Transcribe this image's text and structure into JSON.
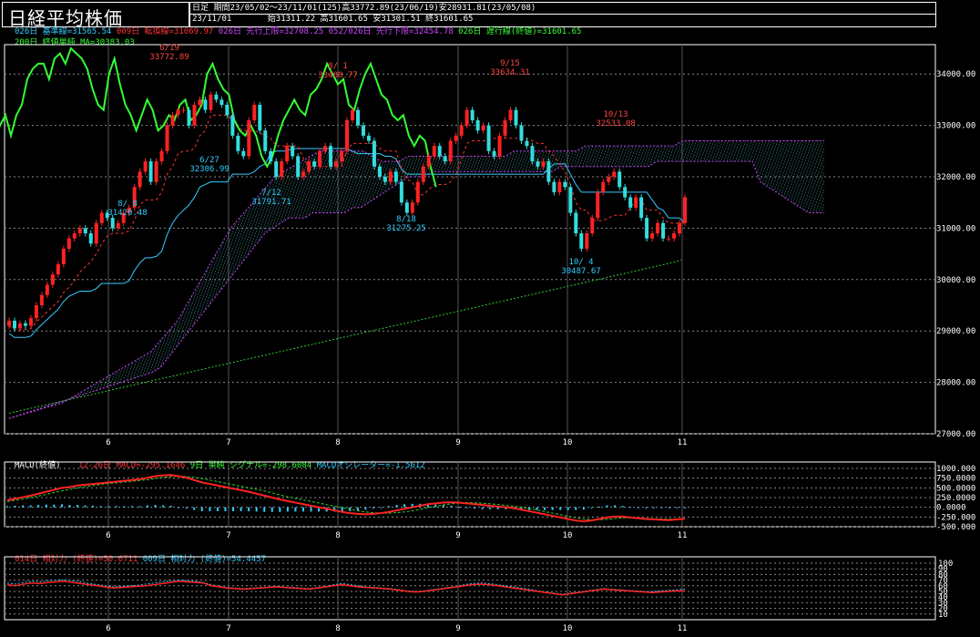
{
  "title": "日経平均株価",
  "header": {
    "period_label": "日足",
    "period_info": "期間23/05/02～23/11/01(125)高33772.89(23/06/19)安28931.81(23/05/08)",
    "date": "23/11/01",
    "ohlc": "始31311.22 高31601.65 安31301.51 終31601.65"
  },
  "main_legend": {
    "kijun": {
      "text": "026日 基準線=31565.54",
      "color": "#33ccff"
    },
    "tenkan": {
      "text": "009日 転換線=31069.97",
      "color": "#ff3333"
    },
    "senkou1": {
      "text": "026日 先行上限=32708.25",
      "color": "#cc44ff"
    },
    "senkou2": {
      "text": "052/026日 先行下限=32454.78",
      "color": "#cc44ff"
    },
    "chikou": {
      "text": "026日 遅行線(終値)=31601.65",
      "color": "#33ff33"
    },
    "ma200": {
      "text": "200日 終値単純 MA=30383.03",
      "color": "#33ff33"
    }
  },
  "macd_legend": {
    "label": {
      "text": "MACD(終値)",
      "color": "#ffffff"
    },
    "macd": {
      "text": "12-26日 MACD=-295.1646",
      "color": "#ff3333"
    },
    "signal": {
      "text": "9日 単純 シグナル=-298.6084",
      "color": "#33ff33"
    },
    "osc": {
      "text": "MACDオシレーター=-1.5612",
      "color": "#33ccff"
    }
  },
  "rsi_legend": {
    "rsi14": {
      "text": "014日 相対力 (終値)=50.6711",
      "color": "#ff3333"
    },
    "rsi9": {
      "text": "009日 相対力 (終値)=54.4457",
      "color": "#33ccff"
    }
  },
  "chart_data": [
    {
      "type": "candlestick",
      "title": "日経平均株価",
      "ylim": [
        27000,
        34500
      ],
      "y_ticks": [
        "34000.00",
        "33000.00",
        "32000.00",
        "31000.00",
        "30000.00",
        "29000.00",
        "28000.00",
        "27000.00"
      ],
      "x_ticks": [
        "6",
        "7",
        "8",
        "9",
        "10",
        "11"
      ],
      "annotations": [
        {
          "label": "6/19",
          "value": "33772.89"
        },
        {
          "label": "8/ 1",
          "value": "33488.77"
        },
        {
          "label": "9/15",
          "value": "33634.31"
        },
        {
          "label": "10/13",
          "value": "32533.08"
        },
        {
          "label": "8/ 8",
          "value": "31420.48"
        },
        {
          "label": "6/27",
          "value": "32306.99"
        },
        {
          "label": "7/12",
          "value": "31791.71"
        },
        {
          "label": "8/18",
          "value": "31275.25"
        },
        {
          "label": "10/ 4",
          "value": "30487.67"
        }
      ],
      "close": [
        29200,
        29050,
        29150,
        29100,
        29250,
        29500,
        29700,
        29900,
        30100,
        30300,
        30600,
        30800,
        30900,
        31000,
        30900,
        30700,
        31100,
        31300,
        31200,
        31000,
        31100,
        31300,
        31400,
        31800,
        32100,
        32300,
        31900,
        32300,
        32500,
        33000,
        33200,
        33300,
        33300,
        33000,
        33400,
        33500,
        33300,
        33600,
        33500,
        33400,
        33200,
        32800,
        32500,
        32400,
        33100,
        33400,
        32900,
        32500,
        32300,
        32000,
        32300,
        32600,
        32400,
        32000,
        32100,
        32300,
        32200,
        32500,
        32600,
        32200,
        32300,
        32500,
        33100,
        33300,
        33000,
        32800,
        32700,
        32200,
        32000,
        31900,
        32100,
        31900,
        31500,
        31300,
        31500,
        31900,
        32200,
        32400,
        32600,
        32400,
        32300,
        32700,
        32800,
        33000,
        33300,
        33100,
        32900,
        33000,
        32500,
        32400,
        32800,
        33100,
        33300,
        33000,
        32700,
        32600,
        32300,
        32200,
        32300,
        31900,
        31700,
        31900,
        31800,
        31300,
        30900,
        30600,
        30900,
        31200,
        31700,
        31900,
        32000,
        32100,
        31800,
        31600,
        31400,
        31600,
        31200,
        30800,
        30900,
        31100,
        30800,
        30800,
        30900,
        31100,
        31602
      ],
      "ma200": [
        27400,
        27430,
        27460,
        27490,
        27520,
        27550,
        27580,
        27610,
        27640,
        27670,
        27700,
        27730,
        27760,
        27790,
        27820,
        27850,
        27880,
        27910,
        27940,
        27970,
        28000,
        28030,
        28060,
        28090,
        28120,
        28150,
        28180,
        28210,
        28240,
        28270,
        28300,
        28330,
        28360,
        28390,
        28420,
        28450,
        28480,
        28510,
        28540,
        28570,
        28600,
        28630,
        28660,
        28690,
        28720,
        28750,
        28780,
        28810,
        28840,
        28870,
        28900,
        28930,
        28960,
        28990,
        29020,
        29050,
        29080,
        29110,
        29140,
        29170,
        29200,
        29230,
        29260,
        29290,
        29320,
        29350,
        29380,
        29410,
        29440,
        29470,
        29500,
        29530,
        29560,
        29590,
        29620,
        29650,
        29680,
        29710,
        29740,
        29770,
        29800,
        29830,
        29860,
        29890,
        29920,
        29950,
        29980,
        30010,
        30040,
        30070,
        30100,
        30130,
        30160,
        30190,
        30220,
        30250,
        30280,
        30310,
        30340,
        30383
      ],
      "senkou_a": [
        27300,
        27350,
        27400,
        27450,
        27500,
        27550,
        27600,
        27700,
        27800,
        27900,
        28000,
        28100,
        28200,
        28300,
        28400,
        28500,
        28600,
        28800,
        29000,
        29200,
        29500,
        29800,
        30100,
        30400,
        30700,
        31000,
        31200,
        31400,
        31600,
        31800,
        32000,
        32100,
        32200,
        32300,
        32400,
        32500,
        32500,
        32500,
        32500,
        32500,
        32500,
        32400,
        32300,
        32300,
        32300,
        32400,
        32400,
        32400,
        32400,
        32400,
        32400,
        32400,
        32400,
        32400,
        32400,
        32400,
        32400,
        32500,
        32500,
        32500,
        32500,
        32500,
        32500,
        32500,
        32500,
        32600,
        32600,
        32600,
        32600,
        32600,
        32600,
        32600,
        32600,
        32600,
        32600,
        32600,
        32700,
        32700,
        32700,
        32700,
        32700,
        32700,
        32700,
        32700,
        32700,
        32700,
        32700,
        32700,
        32700,
        32700,
        32700,
        32700,
        32708
      ],
      "senkou_b": [
        27300,
        27350,
        27400,
        27450,
        27500,
        27550,
        27600,
        27650,
        27700,
        27750,
        27800,
        27850,
        27900,
        27950,
        28000,
        28050,
        28100,
        28150,
        28200,
        28300,
        28500,
        28700,
        28900,
        29100,
        29300,
        29500,
        29700,
        29900,
        30100,
        30300,
        30500,
        30700,
        30900,
        31000,
        31100,
        31200,
        31200,
        31200,
        31300,
        31300,
        31300,
        31300,
        31300,
        31400,
        31400,
        31500,
        31600,
        31700,
        31800,
        31900,
        32000,
        32000,
        32000,
        32100,
        32100,
        32100,
        32100,
        32100,
        32100,
        32100,
        32100,
        32100,
        32100,
        32100,
        32100,
        32100,
        32100,
        32100,
        32100,
        32200,
        32200,
        32200,
        32200,
        32200,
        32200,
        32200,
        32200,
        32200,
        32200,
        32200,
        32200,
        32300,
        32300,
        32300,
        32300,
        32300,
        32300,
        32300,
        32300,
        32300,
        32300,
        32300,
        32300,
        32300,
        31900,
        31800,
        31700,
        31600,
        31500,
        31400,
        31300,
        31300,
        31300
      ]
    },
    {
      "type": "line",
      "title": "MACD(終値)",
      "ylim": [
        -500,
        1000
      ],
      "y_ticks": [
        "1000.000",
        "750.0000",
        "500.0000",
        "250.0000",
        "0.0000",
        "-250.000",
        "-500.000"
      ],
      "series": [
        {
          "name": "12-26日 MACD",
          "values": [
            180,
            220,
            260,
            300,
            350,
            400,
            450,
            500,
            520,
            560,
            580,
            600,
            620,
            640,
            660,
            680,
            700,
            720,
            760,
            800,
            820,
            830,
            800,
            760,
            700,
            640,
            600,
            560,
            520,
            480,
            440,
            400,
            350,
            300,
            250,
            200,
            160,
            120,
            80,
            40,
            0,
            -40,
            -80,
            -120,
            -150,
            -170,
            -180,
            -170,
            -150,
            -120,
            -80,
            -40,
            0,
            40,
            80,
            100,
            120,
            130,
            120,
            100,
            80,
            60,
            40,
            20,
            0,
            -20,
            -60,
            -100,
            -140,
            -180,
            -220,
            -260,
            -300,
            -340,
            -360,
            -340,
            -300,
            -260,
            -240,
            -240,
            -260,
            -280,
            -300,
            -310,
            -320,
            -330,
            -310,
            -295
          ]
        },
        {
          "name": "9日 単純 シグナル",
          "values": [
            150,
            180,
            210,
            250,
            290,
            330,
            380,
            420,
            460,
            500,
            530,
            560,
            590,
            610,
            630,
            650,
            670,
            690,
            710,
            740,
            770,
            790,
            800,
            790,
            770,
            740,
            700,
            660,
            620,
            580,
            540,
            500,
            460,
            420,
            370,
            320,
            270,
            230,
            190,
            150,
            110,
            70,
            30,
            -10,
            -50,
            -90,
            -120,
            -140,
            -150,
            -150,
            -140,
            -120,
            -90,
            -50,
            -10,
            30,
            60,
            90,
            110,
            120,
            115,
            105,
            90,
            70,
            50,
            30,
            0,
            -30,
            -70,
            -110,
            -150,
            -190,
            -230,
            -270,
            -300,
            -320,
            -320,
            -310,
            -290,
            -275,
            -270,
            -275,
            -285,
            -295,
            -300,
            -305,
            -305,
            -299
          ]
        }
      ],
      "oscillator": [
        30,
        40,
        50,
        50,
        60,
        70,
        70,
        80,
        60,
        60,
        50,
        40,
        30,
        30,
        30,
        30,
        30,
        30,
        50,
        60,
        50,
        40,
        0,
        -30,
        -70,
        -100,
        -100,
        -100,
        -100,
        -100,
        -100,
        -100,
        -110,
        -120,
        -120,
        -120,
        -110,
        -110,
        -110,
        -110,
        -110,
        -110,
        -110,
        -110,
        -100,
        -80,
        -60,
        -30,
        0,
        30,
        60,
        80,
        90,
        90,
        90,
        70,
        60,
        40,
        10,
        -20,
        -35,
        -45,
        -50,
        -50,
        -50,
        -50,
        -60,
        -70,
        -70,
        -70,
        -70,
        -70,
        -70,
        -70,
        -60,
        -20,
        20,
        50,
        50,
        35,
        10,
        -5,
        -15,
        -15,
        -20,
        -25,
        -5,
        -2
      ]
    },
    {
      "type": "line",
      "title": "相対力",
      "ylim": [
        0,
        100
      ],
      "y_ticks": [
        "100",
        "90",
        "80",
        "70",
        "60",
        "50",
        "40",
        "30",
        "20",
        "10"
      ],
      "series": [
        {
          "name": "014日 相対力 (終値)",
          "values": [
            62,
            60,
            63,
            65,
            64,
            66,
            67,
            68,
            66,
            64,
            62,
            60,
            58,
            56,
            57,
            58,
            59,
            60,
            62,
            64,
            66,
            68,
            67,
            66,
            65,
            60,
            58,
            56,
            55,
            54,
            55,
            56,
            57,
            58,
            57,
            56,
            55,
            54,
            56,
            58,
            60,
            62,
            60,
            58,
            57,
            56,
            55,
            54,
            52,
            50,
            49,
            50,
            52,
            54,
            56,
            58,
            60,
            62,
            63,
            62,
            60,
            58,
            56,
            54,
            52,
            50,
            48,
            46,
            44,
            46,
            48,
            50,
            52,
            54,
            53,
            52,
            51,
            50,
            49,
            48,
            49,
            50,
            51,
            51
          ]
        },
        {
          "name": "009日 相対力 (終値)",
          "values": [
            65,
            63,
            66,
            68,
            67,
            69,
            70,
            71,
            69,
            67,
            64,
            62,
            60,
            58,
            59,
            60,
            61,
            63,
            65,
            67,
            69,
            70,
            69,
            68,
            66,
            62,
            59,
            57,
            56,
            55,
            56,
            57,
            58,
            59,
            58,
            57,
            56,
            55,
            57,
            59,
            62,
            64,
            62,
            60,
            58,
            57,
            56,
            55,
            53,
            51,
            50,
            51,
            53,
            55,
            57,
            59,
            62,
            64,
            65,
            64,
            62,
            60,
            58,
            56,
            54,
            51,
            49,
            47,
            45,
            47,
            49,
            51,
            53,
            55,
            54,
            53,
            52,
            51,
            50,
            50,
            51,
            52,
            53,
            54
          ]
        }
      ]
    }
  ]
}
